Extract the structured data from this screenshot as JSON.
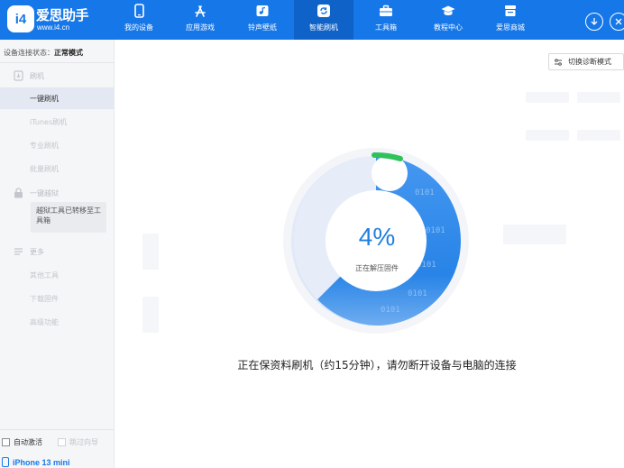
{
  "brand": {
    "logo_text": "i4",
    "name": "爱思助手",
    "url": "www.i4.cn"
  },
  "nav": {
    "items": [
      {
        "label": "我的设备",
        "icon": "phone-icon"
      },
      {
        "label": "应用游戏",
        "icon": "app-store-icon"
      },
      {
        "label": "铃声壁纸",
        "icon": "music-wallpaper-icon"
      },
      {
        "label": "智能刷机",
        "icon": "refresh-icon",
        "active": true
      },
      {
        "label": "工具箱",
        "icon": "toolbox-icon"
      },
      {
        "label": "教程中心",
        "icon": "graduation-cap-icon"
      },
      {
        "label": "爱思商城",
        "icon": "shop-icon"
      }
    ],
    "right_buttons": [
      "download-icon",
      "close-icon"
    ]
  },
  "sidebar": {
    "status_label": "设备连接状态：",
    "status_value": "正常模式",
    "sections": [
      {
        "title": "刷机",
        "icon": "flash-icon",
        "items": [
          "一键刷机",
          "iTunes刷机",
          "专业刷机",
          "批量刷机"
        ]
      },
      {
        "title": "一键越狱",
        "icon": "lock-icon",
        "notice": "越狱工具已转移至工具箱"
      },
      {
        "title": "更多",
        "icon": "menu-icon",
        "items": [
          "其他工具",
          "下载固件",
          "高级功能"
        ]
      }
    ],
    "active_item": "一键刷机",
    "auto_activate": "自动激活",
    "skip_guide": "跳过向导",
    "device_name": "iPhone 13 mini"
  },
  "main": {
    "switch_mode_button": "切换诊断模式",
    "progress_percent": 4,
    "progress_text": "4%",
    "progress_status": "正在解压固件",
    "notice": "正在保资料刷机（约15分钟），请勿断开设备与电脑的连接",
    "decor_binary": "0101"
  },
  "colors": {
    "accent": "#1677e8",
    "nav_active": "#0f63c8",
    "progress_green": "#2fc25b",
    "sidebar_bg": "#f5f6f8",
    "sidebar_active": "#e3e8f2"
  }
}
